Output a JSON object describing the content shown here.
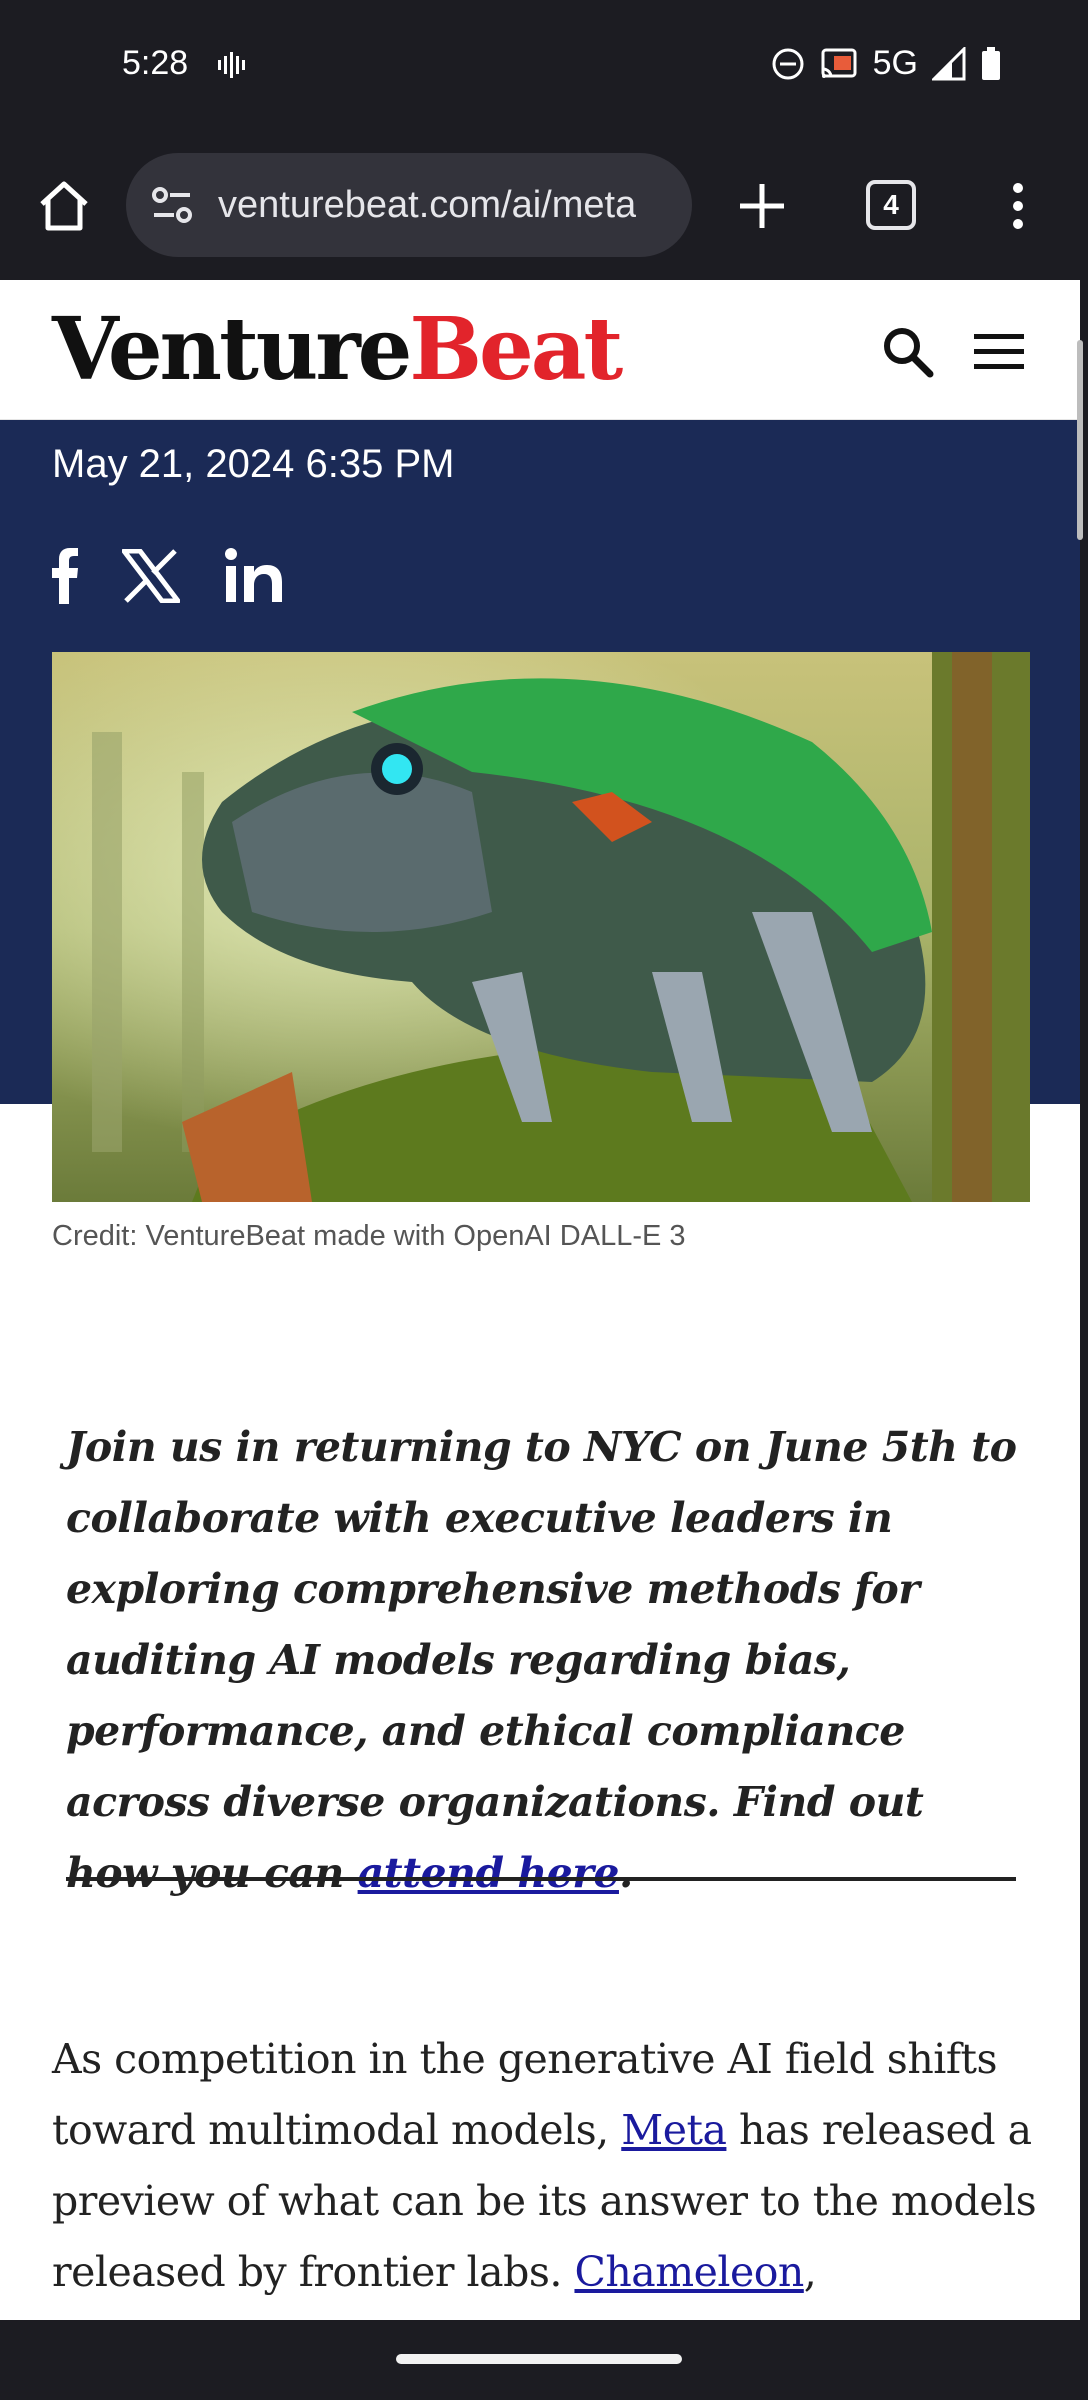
{
  "status_bar": {
    "time": "5:28",
    "network": "5G"
  },
  "browser": {
    "url": "venturebeat.com/ai/meta",
    "tab_count": "4"
  },
  "site": {
    "logo_part1": "Venture",
    "logo_part2": "Beat",
    "brand_red": "#e2242b",
    "hero_bg": "#1b2a56"
  },
  "article": {
    "date": "May 21, 2024 6:35 PM",
    "share": [
      "facebook-icon",
      "x-icon",
      "linkedin-icon"
    ],
    "image_credit": "Credit: VentureBeat made with OpenAI DALL-E 3",
    "promo_text": "Join us in returning to NYC on June 5th to collaborate with executive leaders in exploring comprehensive methods for auditing AI models regarding bias, performance, and ethical compliance across diverse organizations. Find out how you can ",
    "promo_link": "attend here",
    "promo_end": ".",
    "body_1": "As competition in the generative AI field shifts toward multimodal models, ",
    "body_link_1": "Meta",
    "body_2": " has released a preview of what can be its answer to the models released by frontier labs. ",
    "body_link_2": "Chameleon",
    "body_3": ","
  }
}
